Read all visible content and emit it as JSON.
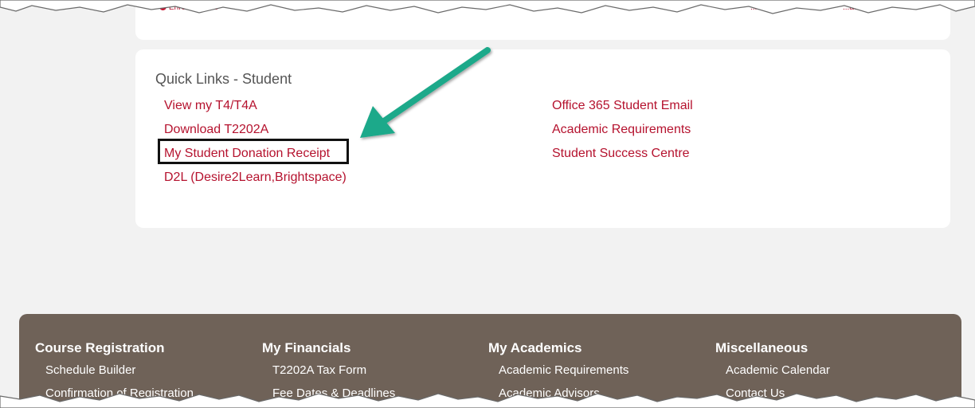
{
  "top_card": {
    "enrolment_snippet": "Enrolmen...es",
    "view_snippet": "...r view)",
    "read_snippet": "...ad a..."
  },
  "quick_links": {
    "title": "Quick Links - Student",
    "left_links": [
      "View my T4/T4A",
      "Download T2202A",
      "My Student Donation Receipt",
      "D2L (Desire2Learn,Brightspace)"
    ],
    "right_links": [
      "Office 365 Student Email",
      "Academic Requirements",
      "Student Success Centre"
    ],
    "highlighted_link": "My Student Donation Receipt"
  },
  "annotation": {
    "arrow_color": "#1fa98a",
    "box_color": "#111111"
  },
  "footer": {
    "columns": [
      {
        "heading": "Course Registration",
        "items": [
          "Schedule Builder",
          "Confirmation of Registration"
        ]
      },
      {
        "heading": "My Financials",
        "items": [
          "T2202A Tax Form",
          "Fee Dates & Deadlines"
        ]
      },
      {
        "heading": "My Academics",
        "items": [
          "Academic Requirements",
          "Academic Advisors"
        ]
      },
      {
        "heading": "Miscellaneous",
        "items": [
          "Academic Calendar",
          "Contact Us"
        ]
      }
    ]
  },
  "colors": {
    "link": "#b5122e",
    "footer_bg": "#6f6258",
    "page_bg": "#f2f2f2",
    "card_bg": "#ffffff"
  }
}
